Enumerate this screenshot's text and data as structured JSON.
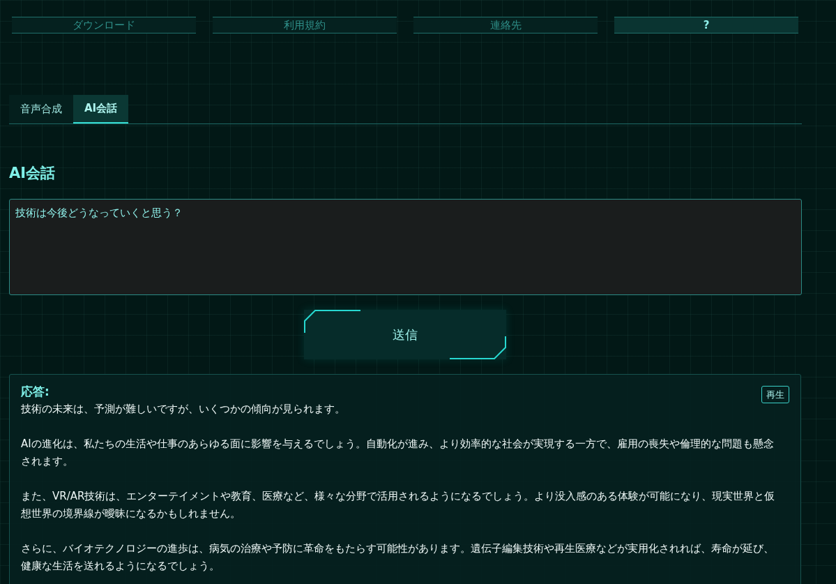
{
  "nav": [
    {
      "label": "ダウンロード",
      "selected": false
    },
    {
      "label": "利用規約",
      "selected": false
    },
    {
      "label": "連絡先",
      "selected": false
    },
    {
      "label": "?",
      "selected": true
    }
  ],
  "tabs": [
    {
      "label": "音声合成",
      "selected": false
    },
    {
      "label": "AI会話",
      "selected": true
    }
  ],
  "heading": "AI会話",
  "prompt": {
    "value": "技術は今後どうなっていくと思う？"
  },
  "send_button": "送信",
  "response": {
    "label": "応答:",
    "play_button": "再生",
    "paragraphs": [
      "技術の未来は、予測が難しいですが、いくつかの傾向が見られます。",
      "AIの進化は、私たちの生活や仕事のあらゆる面に影響を与えるでしょう。自動化が進み、より効率的な社会が実現する一方で、雇用の喪失や倫理的な問題も懸念されます。",
      "また、VR/AR技術は、エンターテイメントや教育、医療など、様々な分野で活用されるようになるでしょう。より没入感のある体験が可能になり、現実世界と仮想世界の境界線が曖昧になるかもしれません。",
      "さらに、バイオテクノロジーの進歩は、病気の治療や予防に革命をもたらす可能性があります。遺伝子編集技術や再生医療などが実用化されれば、寿命が延び、健康な生活を送れるようになるでしょう。"
    ]
  }
}
